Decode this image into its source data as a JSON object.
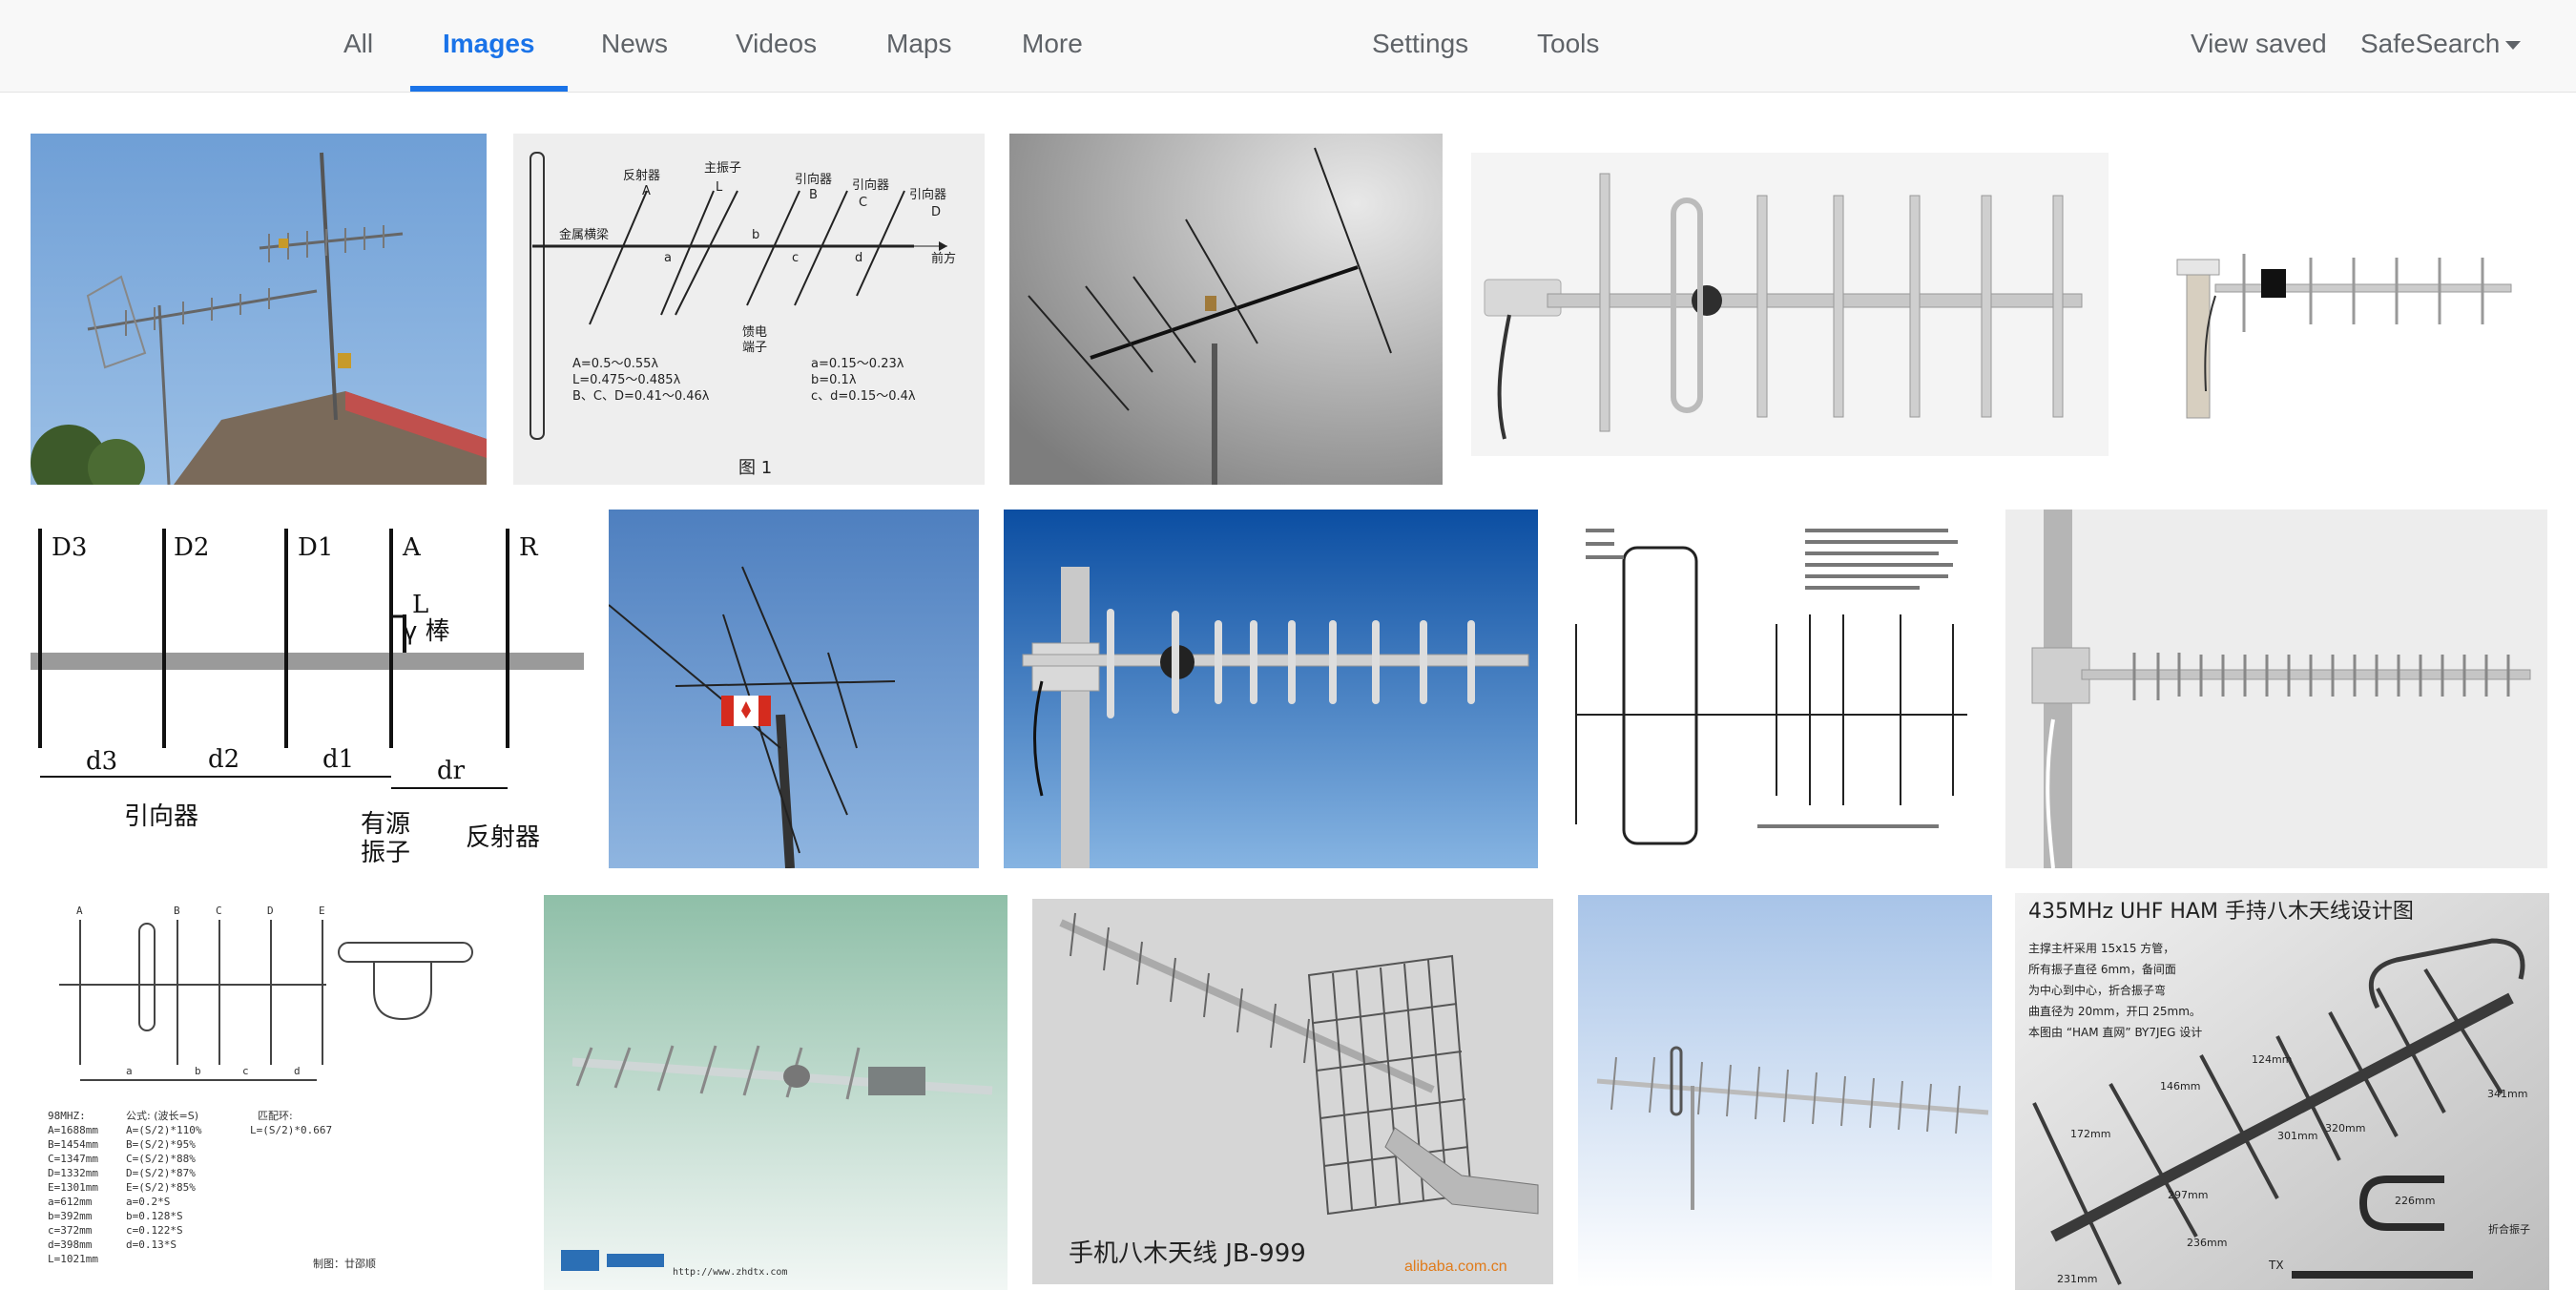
{
  "nav": {
    "tabs": [
      {
        "label": "All"
      },
      {
        "label": "Images",
        "active": true
      },
      {
        "label": "News"
      },
      {
        "label": "Videos"
      },
      {
        "label": "Maps"
      },
      {
        "label": "More"
      }
    ],
    "settings_label": "Settings",
    "tools_label": "Tools",
    "view_saved_label": "View saved",
    "safesearch_label": "SafeSearch"
  },
  "accent_color": "#1a73e8",
  "results": {
    "row1": {
      "t2": {
        "labels": [
          "反射器",
          "主振子",
          "引向器",
          "引向器",
          "引向器",
          "A",
          "L",
          "B",
          "C",
          "D",
          "金属横梁",
          "前方",
          "馈电",
          "端子",
          "a",
          "b",
          "c",
          "d"
        ],
        "formulas": [
          "A=0.5～0.55λ",
          "L=0.475～0.485λ",
          "B、C、D=0.41～0.46λ",
          "a=0.15～0.23λ",
          "b=0.1λ",
          "c、d=0.15～0.4λ"
        ],
        "caption": "图 1"
      }
    },
    "row2": {
      "t6": {
        "top_labels": [
          "D3",
          "D2",
          "D1",
          "A",
          "R"
        ],
        "rod_labels": [
          "L",
          "γ 棒"
        ],
        "dims": [
          "d3",
          "d2",
          "d1",
          "dr"
        ],
        "bottom_labels": [
          "引向器",
          "有源",
          "振子",
          "反射器"
        ]
      }
    },
    "row3": {
      "t11": {
        "top_letters": [
          "A",
          "B",
          "C",
          "D",
          "E"
        ],
        "dims": [
          "a",
          "b",
          "c",
          "d"
        ],
        "col1": [
          "98MHZ:",
          "A=1688mm",
          "B=1454mm",
          "C=1347mm",
          "D=1332mm",
          "E=1301mm",
          "a=612mm",
          "b=392mm",
          "c=372mm",
          "d=398mm",
          "L=1021mm"
        ],
        "col2": [
          "公式: (波长=S)",
          "A=(S/2)*110%",
          "B=(S/2)*95%",
          "C=(S/2)*88%",
          "D=(S/2)*87%",
          "E=(S/2)*85%",
          "a=0.2*S",
          "b=0.128*S",
          "c=0.122*S",
          "d=0.13*S"
        ],
        "col3": [
          "匹配环:",
          "L=(S/2)*0.667"
        ],
        "credit": "制图：廿邵顺"
      },
      "t12": {
        "footer": "http://www.zhdtx.com"
      },
      "t13": {
        "caption": "手机八木天线  JB-999",
        "watermark": "alibaba.com.cn"
      },
      "t15": {
        "title": "435MHz  UHF  HAM 手持八木天线设计图",
        "notes": [
          "主撑主杆采用 15x15 方管，",
          "所有振子直径 6mm，备间面",
          "为中心到中心，折合振子弯",
          "曲直径为 20mm，开口 25mm。",
          "本图由 “HAM 直网” BY7JEG 设计"
        ],
        "dims": [
          "231mm",
          "172mm",
          "146mm",
          "124mm",
          "297mm",
          "301mm",
          "320mm",
          "341mm",
          "236mm",
          "226mm"
        ],
        "bottom_labels": [
          "TX",
          "折合振子"
        ]
      }
    }
  }
}
